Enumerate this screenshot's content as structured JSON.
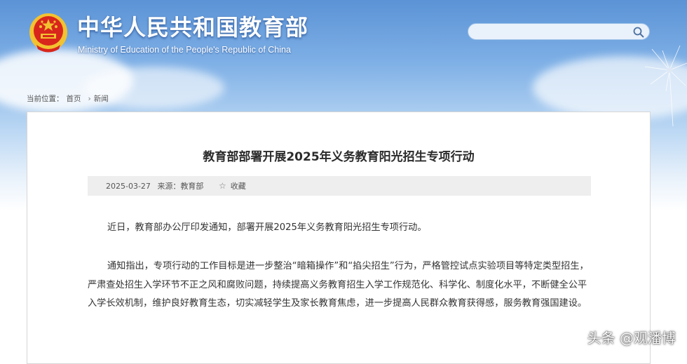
{
  "header": {
    "title": "中华人民共和国教育部",
    "subtitle": "Ministry of Education of the People's Republic of China",
    "search": {
      "placeholder": ""
    }
  },
  "breadcrumb": {
    "prefix": "当前位置：",
    "items": [
      "首页",
      "新闻"
    ]
  },
  "article": {
    "title": "教育部部署开展2025年义务教育阳光招生专项行动",
    "date": "2025-03-27",
    "source_label": "来源：",
    "source": "教育部",
    "favorite_label": "收藏",
    "paragraphs": [
      "近日，教育部办公厅印发通知，部署开展2025年义务教育阳光招生专项行动。",
      "通知指出，专项行动的工作目标是进一步整治“暗箱操作”和“掐尖招生”行为，严格管控试点实验项目等特定类型招生，严肃查处招生入学环节不正之风和腐败问题，持续提高义务教育招生入学工作规范化、科学化、制度化水平，不断健全公平入学长效机制，维护良好教育生态，切实减轻学生及家长教育焦虑，进一步提高人民群众教育获得感，服务教育强国建设。"
    ]
  },
  "watermark": "头条 @观潘博",
  "icons": {
    "emblem": "national-emblem-icon",
    "search": "search-icon",
    "favorite": "star-icon",
    "separator": "chevron-right-icon"
  },
  "colors": {
    "header_blue": "#5b93d6",
    "emblem_red": "#d8261c",
    "emblem_gold": "#f2c230",
    "meta_bar": "#eeeeee"
  }
}
